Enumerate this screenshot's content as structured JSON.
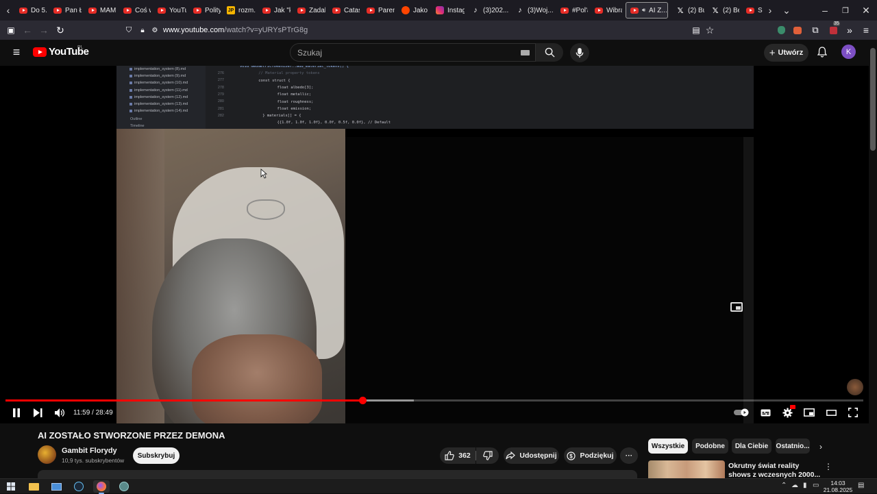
{
  "browser": {
    "tabs": [
      {
        "label": "Do 5...",
        "icon": "youtube-icon",
        "kind": "yt"
      },
      {
        "label": "Pan Ł...",
        "icon": "youtube-icon",
        "kind": "yt"
      },
      {
        "label": "MAM...",
        "icon": "youtube-icon",
        "kind": "yt"
      },
      {
        "label": "Coś w...",
        "icon": "youtube-icon",
        "kind": "yt"
      },
      {
        "label": "YouTu...",
        "icon": "youtube-icon",
        "kind": "yt"
      },
      {
        "label": "Polity...",
        "icon": "youtube-icon",
        "kind": "yt"
      },
      {
        "label": "rozm...",
        "icon": "jp-icon",
        "kind": "jp"
      },
      {
        "label": "Jak \"k...",
        "icon": "youtube-icon",
        "kind": "yt"
      },
      {
        "label": "Zadal...",
        "icon": "youtube-icon",
        "kind": "yt"
      },
      {
        "label": "Catas...",
        "icon": "youtube-icon",
        "kind": "yt"
      },
      {
        "label": "Paren...",
        "icon": "youtube-icon",
        "kind": "yt"
      },
      {
        "label": "Jako s...",
        "icon": "reddit-icon",
        "kind": "rd"
      },
      {
        "label": "Instag...",
        "icon": "instagram-icon",
        "kind": "ig"
      },
      {
        "label": "(3)202...",
        "icon": "tiktok-icon",
        "kind": "tt"
      },
      {
        "label": "(3)Woj...",
        "icon": "tiktok-icon",
        "kind": "tt"
      },
      {
        "label": "#Pol'a...",
        "icon": "youtube-icon",
        "kind": "yt"
      },
      {
        "label": "Wibra...",
        "icon": "youtube-icon",
        "kind": "yt"
      },
      {
        "label": "AI Z...",
        "icon": "youtube-icon",
        "kind": "yt",
        "active": true
      },
      {
        "label": "(2) Bu...",
        "icon": "x-icon",
        "kind": "x"
      },
      {
        "label": "(2) Be...",
        "icon": "x-icon",
        "kind": "x"
      },
      {
        "label": "Sub...",
        "icon": "youtube-icon",
        "kind": "yt"
      }
    ],
    "url_host": "www.youtube.com",
    "url_path": "/watch?v=yURYsPTrG8g",
    "extension_badge": "35"
  },
  "yt_header": {
    "logo_text": "YouTube",
    "country": "PL",
    "search_placeholder": "Szukaj",
    "create_label": "Utwórz",
    "avatar_letter": "K"
  },
  "video_frame": {
    "file_tree": [
      "implementation_system (8).md",
      "implementation_system (9).md",
      "implementation_system (10).md",
      "implementation_system (11).md",
      "implementation_system (12).md",
      "implementation_system (13).md",
      "implementation_system (14).md"
    ],
    "tree_sections": [
      "Outline",
      "Timeline"
    ],
    "line_numbers": [
      "276",
      "277",
      "278",
      "279",
      "280",
      "281",
      "282"
    ],
    "code_lines": [
      "void GeometricTokenizer::add_material_tokens() {",
      "    // Material property tokens",
      "    const struct {",
      "        float albedo[3];",
      "        float metallic;",
      "        float roughness;",
      "        float emission;",
      "    } materials[] = {",
      "        {{1.0f, 1.0f, 1.0f}, 0.0f, 0.5f, 0.0f}, // Default"
    ]
  },
  "player": {
    "current_time": "11:59",
    "duration": "28:49",
    "time_display": "11:59 / 28:49",
    "played_fraction": 0.416,
    "buffered_fraction": 0.476
  },
  "video": {
    "title": "AI ZOSTAŁO STWORZONE PRZEZ DEMONA",
    "channel_name": "Gambit Florydy",
    "subscribers": "10,9 tys. subskrybentów",
    "subscribe_label": "Subskrybuj",
    "likes": "362",
    "share_label": "Udostępnij",
    "thanks_label": "Podziękuj"
  },
  "sidebar": {
    "chips": [
      "Wszystkie",
      "Podobne",
      "Dla Ciebie",
      "Ostatnio..."
    ],
    "active_chip": 0,
    "recommendation_title": "Okrutny świat reality shows z wczesnych 2000..."
  },
  "taskbar": {
    "time": "14:03",
    "date": "21.08.2025"
  },
  "colors": {
    "accent_red": "#ff0000",
    "background": "#0f0f0f",
    "chip_bg": "#272727"
  }
}
